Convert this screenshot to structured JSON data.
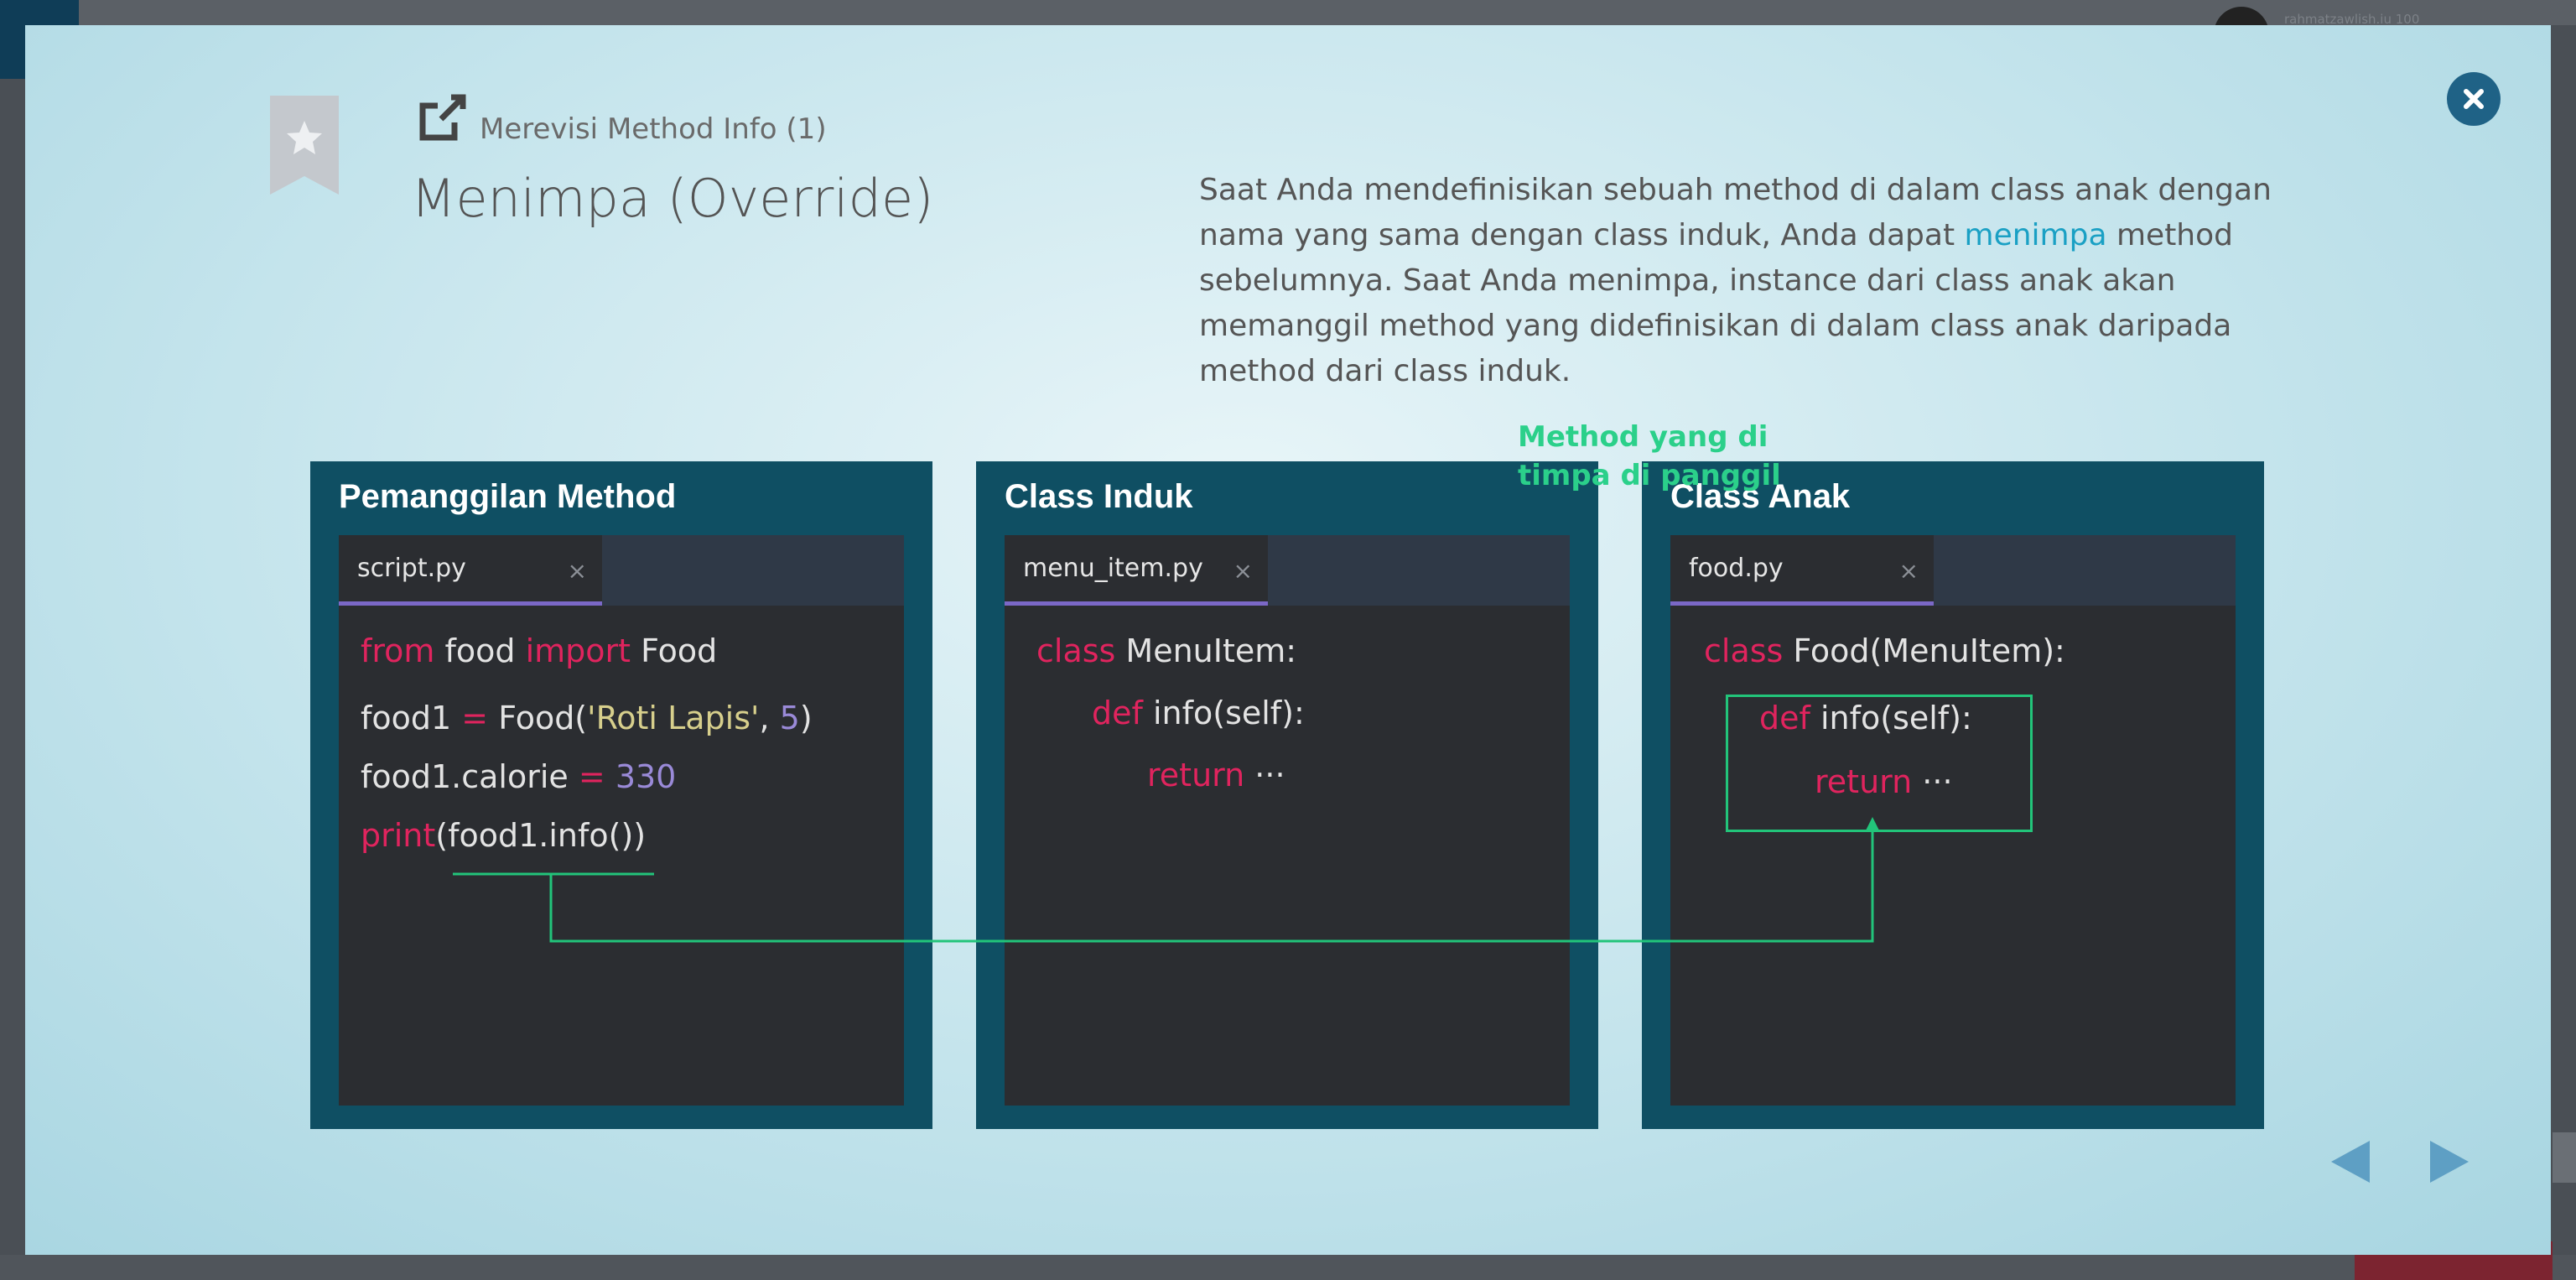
{
  "background": {
    "user_label": "rahmatzawlish.iu 100"
  },
  "lesson": {
    "subtitle": "Merevisi Method Info (1)",
    "title": "Menimpa (Override)",
    "description_part1": "Saat Anda mendefinisikan sebuah method di dalam class anak dengan nama yang sama dengan class induk, Anda dapat ",
    "description_highlight": "menimpa",
    "description_part2": " method sebelumnya. Saat Anda menimpa, instance dari class anak akan memanggil method yang didefinisikan di dalam class anak daripada method dari class induk."
  },
  "panels": [
    {
      "title": "Pemanggilan Method",
      "tab": "script.py",
      "tab_close": "×",
      "lines": [
        {
          "kw1": "from",
          "t1": " food ",
          "kw2": "import",
          "t2": " Food"
        },
        {
          "t1": "food1 ",
          "op": "=",
          "t2": " Food(",
          "str": "'Roti Lapis'",
          "t3": ", ",
          "num": "5",
          "t4": ")"
        },
        {
          "t1": "food1.calorie ",
          "op": "=",
          "num": " 330"
        },
        {
          "kw1": "print",
          "t1": "(food1.info())"
        }
      ]
    },
    {
      "title": "Class Induk",
      "tab": "menu_item.py",
      "tab_close": "×",
      "lines": [
        {
          "kw": "class",
          "t": " MenuItem:"
        },
        {
          "kw": "def",
          "t": " info(self):"
        },
        {
          "kw": "return",
          "t": " ···"
        }
      ]
    },
    {
      "title": "Class Anak",
      "tab": "food.py",
      "tab_close": "×",
      "lines": [
        {
          "kw": "class",
          "t": " Food(MenuItem):"
        },
        {
          "kw": "def",
          "t": " info(self):"
        },
        {
          "kw": "return",
          "t": " ···"
        }
      ],
      "annotation_line1": "Method yang di",
      "annotation_line2": "timpa di panggil"
    }
  ],
  "colors": {
    "panel_bg": "#0f4f63",
    "editor_bg": "#2b2d31",
    "keyword": "#e0245e",
    "string": "#d7cf8c",
    "number": "#9a8ad8",
    "annotation": "#2bd08a",
    "close_button": "#1f6286",
    "link_highlight": "#1aa0c4"
  },
  "icons": {
    "close": "close-icon",
    "bookmark": "bookmark-star-icon",
    "external": "external-link-icon",
    "prev": "triangle-left-icon",
    "next": "triangle-right-icon"
  }
}
